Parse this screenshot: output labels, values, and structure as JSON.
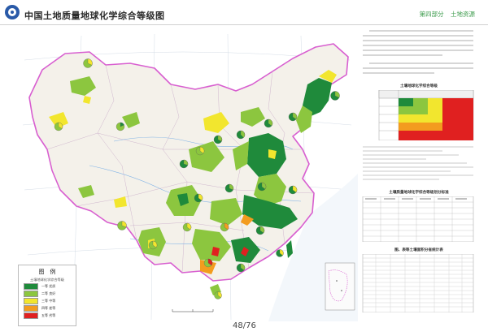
{
  "header": {
    "title": "中国土地质量地球化学综合等级图",
    "nav": [
      "第四部分",
      "土地资源"
    ]
  },
  "pager": {
    "indicator": "48/76"
  },
  "legend": {
    "title": "图　例",
    "subtitle": "土壤地球化学综合等级",
    "items": [
      {
        "label": "一等 优质",
        "color": "#1f8a3b"
      },
      {
        "label": "二等 良好",
        "color": "#8cc63f"
      },
      {
        "label": "三等 中等",
        "color": "#f2e62e"
      },
      {
        "label": "四等 差等",
        "color": "#f39c1f"
      },
      {
        "label": "五等 劣等",
        "color": "#e02020"
      }
    ]
  },
  "tables": {
    "t1_title": "土壤地球化学综合等级",
    "t2_title": "土壤质量地球化学综合等级划分标准",
    "t3_title": "图、表等土壤面积分省统计表"
  },
  "colors": {
    "green": "#1f8a3b",
    "lime": "#8cc63f",
    "yellow": "#f2e62e",
    "orange": "#f39c1f",
    "red": "#e02020",
    "boundary": "#d85fd0"
  }
}
